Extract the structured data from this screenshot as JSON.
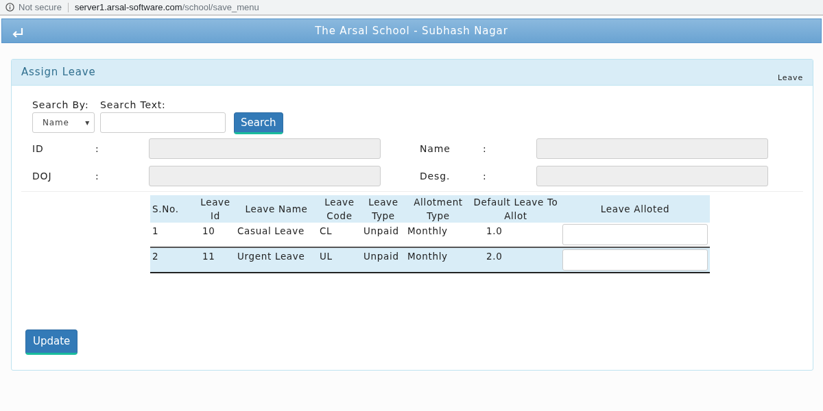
{
  "browser": {
    "security": "Not secure",
    "url_host": "server1.arsal-software.com",
    "url_path": "/school/save_menu"
  },
  "header": {
    "title": "The Arsal School - Subhash Nagar"
  },
  "panel": {
    "title": "Assign Leave",
    "breadcrumb": "Leave"
  },
  "search": {
    "by_label": "Search By:",
    "text_label": "Search Text:",
    "by_value": "Name",
    "caret": "▾",
    "button": "Search"
  },
  "fields": [
    {
      "label": "ID",
      "colon": ":"
    },
    {
      "label": "Name",
      "colon": ":"
    },
    {
      "label": "DOJ",
      "colon": ":"
    },
    {
      "label": "Desg.",
      "colon": ":"
    }
  ],
  "table": {
    "columns": [
      "S.No.",
      "Leave Id",
      "Leave Name",
      "Leave Code",
      "Leave Type",
      "Allotment Type",
      "Default Leave To Allot",
      "Leave Alloted"
    ],
    "rows": [
      [
        "1",
        "10",
        "Casual Leave",
        "CL",
        "Unpaid",
        "Monthly",
        "1.0"
      ],
      [
        "2",
        "11",
        "Urgent Leave",
        "UL",
        "Unpaid",
        "Monthly",
        "2.0"
      ]
    ]
  },
  "update_button": "Update"
}
